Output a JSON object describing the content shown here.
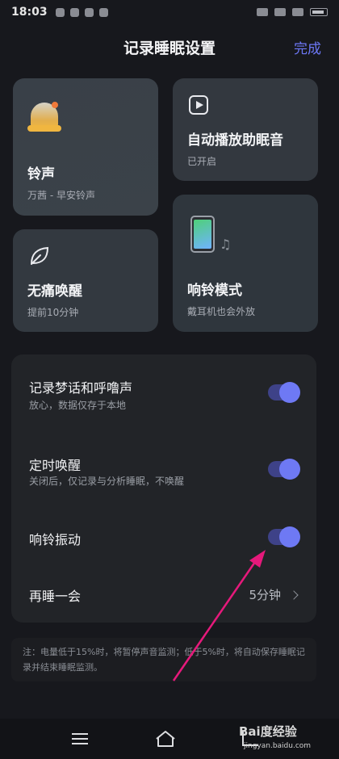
{
  "status_bar": {
    "time": "18:03"
  },
  "header": {
    "title": "记录睡眠设置",
    "done_label": "完成"
  },
  "cards": {
    "ringtone": {
      "title": "铃声",
      "subtitle": "万茜 - 早安铃声",
      "icon": "bell-icon"
    },
    "autoplay": {
      "title": "自动播放助眠音",
      "subtitle": "已开启",
      "icon": "play-icon"
    },
    "painless": {
      "title": "无痛唤醒",
      "subtitle": "提前10分钟",
      "icon": "leaf-icon"
    },
    "ring_mode": {
      "title": "响铃模式",
      "subtitle": "戴耳机也会外放",
      "icon": "phone-icon"
    }
  },
  "settings": {
    "record_sounds": {
      "title": "记录梦话和呼噜声",
      "subtitle": "放心，数据仅存于本地",
      "enabled": true
    },
    "timed_wake": {
      "title": "定时唤醒",
      "subtitle": "关闭后，仅记录与分析睡眠，不唤醒",
      "enabled": true
    },
    "ring_vibrate": {
      "title": "响铃振动",
      "enabled": true
    },
    "snooze": {
      "title": "再睡一会",
      "value": "5分钟"
    }
  },
  "note": {
    "text": "注：电量低于15%时，将暂停声音监测；低于5%时，将自动保存睡眠记录并结束睡眠监测。"
  },
  "watermark": {
    "brand": "Bai度经验",
    "url": "jingyan.baidu.com"
  },
  "colors": {
    "accent": "#6e79f4",
    "background": "#17181d",
    "annotation_arrow": "#e6197b"
  }
}
